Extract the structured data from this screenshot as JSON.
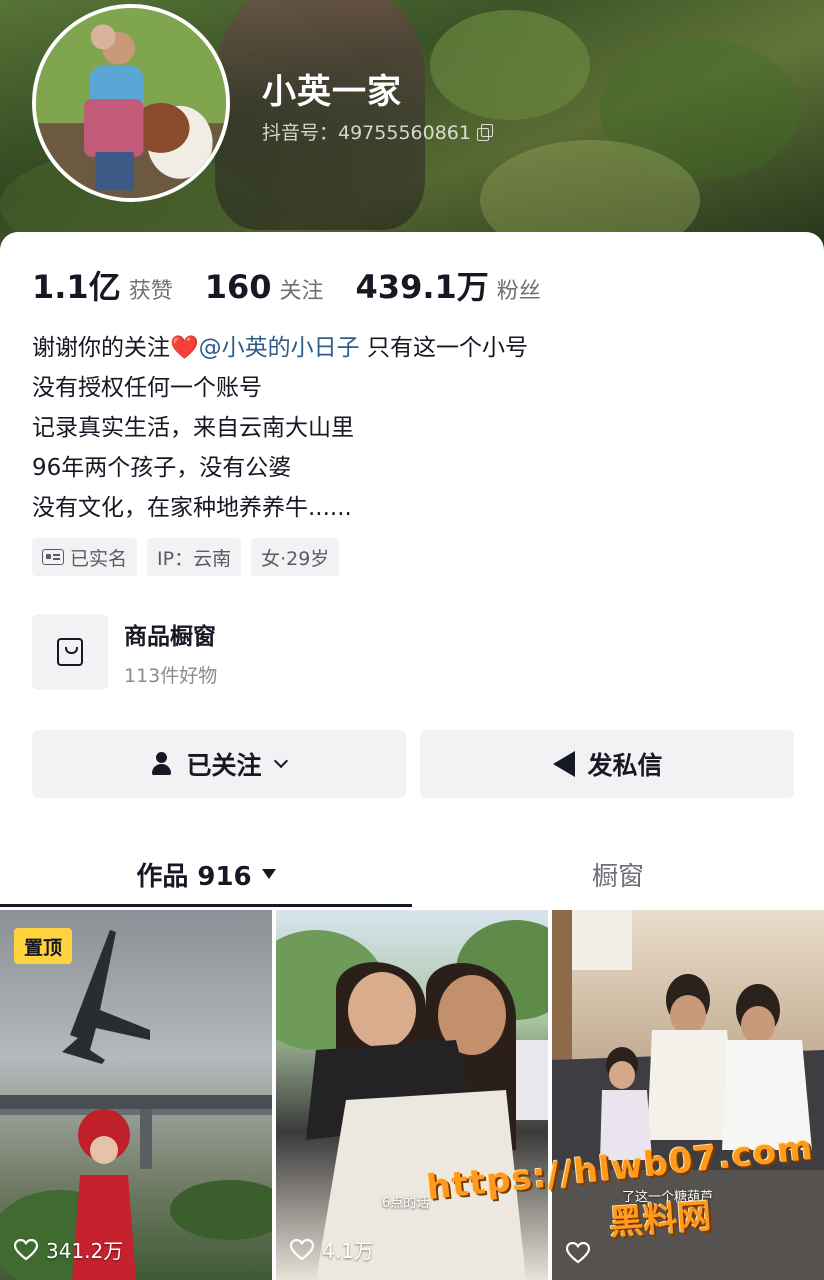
{
  "profile": {
    "nickname": "小英一家",
    "douyin_id": "抖音号：49755560861",
    "copy_icon": "copy-icon"
  },
  "stats": [
    {
      "value": "1.1亿",
      "label": "获赞"
    },
    {
      "value": "160",
      "label": "关注"
    },
    {
      "value": "439.1万",
      "label": "粉丝"
    }
  ],
  "bio": {
    "line1_prefix": "谢谢你的关注",
    "heart": "❤️",
    "mention": "@小英的小日子",
    "line1_suffix": " 只有这一个小号",
    "line2": "没有授权任何一个账号",
    "line3": "记录真实生活，来自云南大山里",
    "line4": "96年两个孩子，没有公婆",
    "line5": "没有文化，在家种地养养牛......"
  },
  "tags": {
    "verified": "已实名",
    "ip": "IP：云南",
    "gender_age": "女·29岁"
  },
  "shop": {
    "title": "商品橱窗",
    "subtitle": "113件好物"
  },
  "buttons": {
    "follow": "已关注",
    "message": "发私信"
  },
  "tabs": {
    "works": "作品 916",
    "window": "橱窗"
  },
  "videos": [
    {
      "pinned_label": "置顶",
      "likes": "341.2万",
      "caption": ""
    },
    {
      "likes": "4.1万",
      "caption": "6点的话"
    },
    {
      "likes": "",
      "caption": "了这一个糖葫芦"
    }
  ],
  "watermark": {
    "url": "https://hlwb07.com",
    "name": "黑料网"
  },
  "colors": {
    "accent_link": "#2f5d8a",
    "pin_badge": "#ffd33d",
    "heart": "#e8343a",
    "watermark": "#ff9a1f"
  }
}
